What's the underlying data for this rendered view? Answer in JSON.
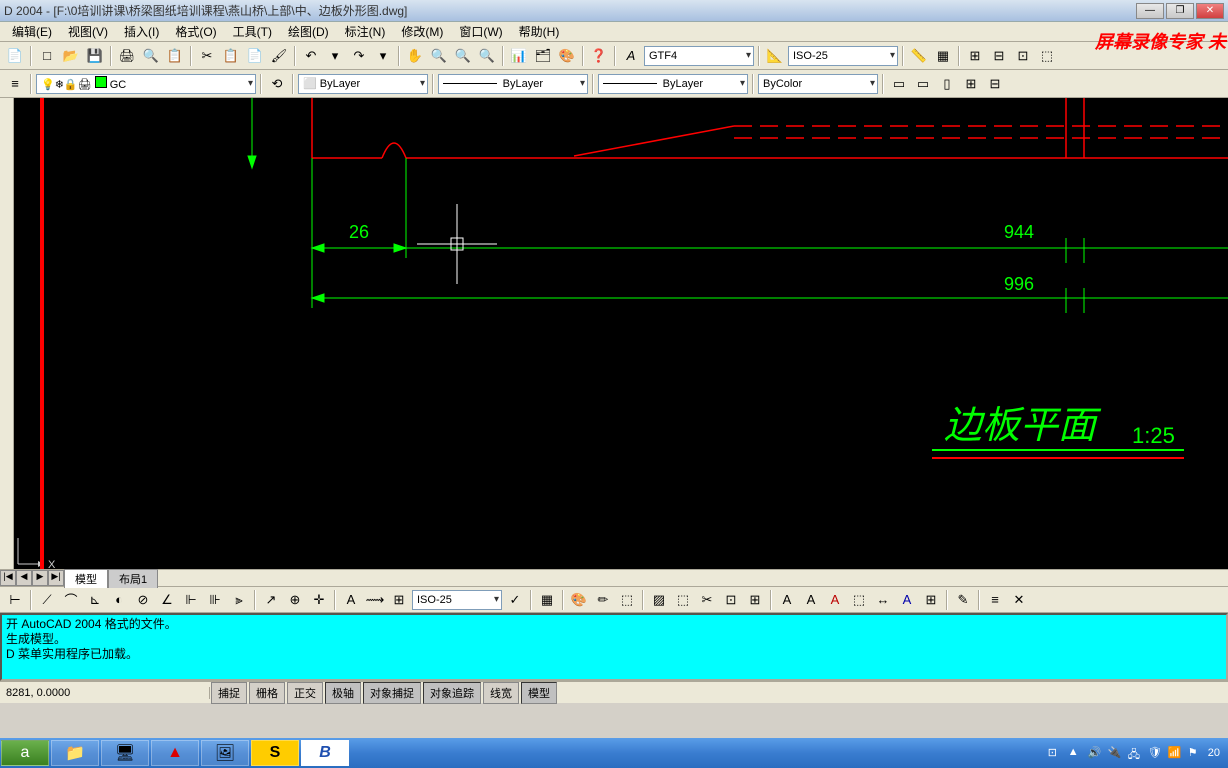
{
  "titlebar": {
    "text": "D 2004 - [F:\\0培训讲课\\桥梁图纸培训课程\\燕山桥\\上部\\中、边板外形图.dwg]"
  },
  "watermark": "屏幕录像专家 未",
  "menus": {
    "edit": "编辑(E)",
    "view": "视图(V)",
    "insert": "插入(I)",
    "format": "格式(O)",
    "tools": "工具(T)",
    "draw": "绘图(D)",
    "dimension": "标注(N)",
    "modify": "修改(M)",
    "window": "窗口(W)",
    "help": "帮助(H)"
  },
  "toolbar1": {
    "textstyle": "GTF4",
    "dimstyle": "ISO-25"
  },
  "toolbar2": {
    "layer": "GC",
    "color": "ByLayer",
    "linetype": "ByLayer",
    "lineweight": "ByLayer",
    "plotstyle": "ByColor"
  },
  "drawing": {
    "dim1": "26",
    "dim2": "944",
    "dim3": "996",
    "title": "边板平面",
    "scale": "1:25",
    "axis_x": "X"
  },
  "layout": {
    "nav": [
      "|◀",
      "◀",
      "▶",
      "▶|"
    ],
    "tab_model": "模型",
    "tab_layout1": "布局1"
  },
  "bottom": {
    "dimstyle": "ISO-25"
  },
  "command": {
    "line1": "开 AutoCAD 2004 格式的文件。",
    "line2": "生成模型。",
    "line3": "D 菜单实用程序已加载。"
  },
  "status": {
    "coord": "8281, 0.0000",
    "snap": "捕捉",
    "grid": "栅格",
    "ortho": "正交",
    "polar": "极轴",
    "osnap": "对象捕捉",
    "otrack": "对象追踪",
    "lwt": "线宽",
    "model": "模型"
  },
  "tray": {
    "time": "20"
  }
}
